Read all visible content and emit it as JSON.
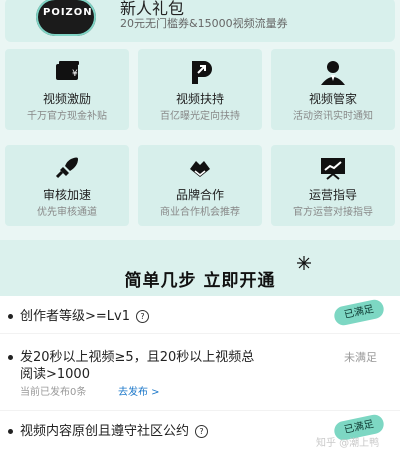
{
  "gift": {
    "logo": "POIZON",
    "title": "新人礼包",
    "subtitle": "20元无门槛券&15000视频流量券"
  },
  "cards": [
    {
      "title": "视频激励",
      "subtitle": "千万官方现金补贴",
      "icon": "card-yen-icon"
    },
    {
      "title": "视频扶持",
      "subtitle": "百亿曝光定向扶持",
      "icon": "p-boost-icon"
    },
    {
      "title": "视频管家",
      "subtitle": "活动资讯实时通知",
      "icon": "manager-icon"
    },
    {
      "title": "审核加速",
      "subtitle": "优先审核通道",
      "icon": "rocket-icon"
    },
    {
      "title": "品牌合作",
      "subtitle": "商业合作机会推荐",
      "icon": "handshake-icon"
    },
    {
      "title": "运营指导",
      "subtitle": "官方运营对接指导",
      "icon": "chart-board-icon"
    }
  ],
  "steps": {
    "headline": "简单几步 立即开通",
    "req1": {
      "text": "创作者等级>=Lv1",
      "status": "已满足"
    },
    "req2": {
      "line1": "发20秒以上视频≥5，且20秒以上视频总",
      "line2": "阅读>1000",
      "status": "未满足",
      "published": "当前已发布0条",
      "action": "去发布 >"
    },
    "req3": {
      "text": "视频内容原创且遵守社区公约",
      "status": "已满足"
    }
  },
  "watermark": "知乎 @潮上鸭",
  "colors": {
    "mint": "#7dd7c3",
    "bg": "#e8f5f3",
    "link": "#1b77c9"
  }
}
